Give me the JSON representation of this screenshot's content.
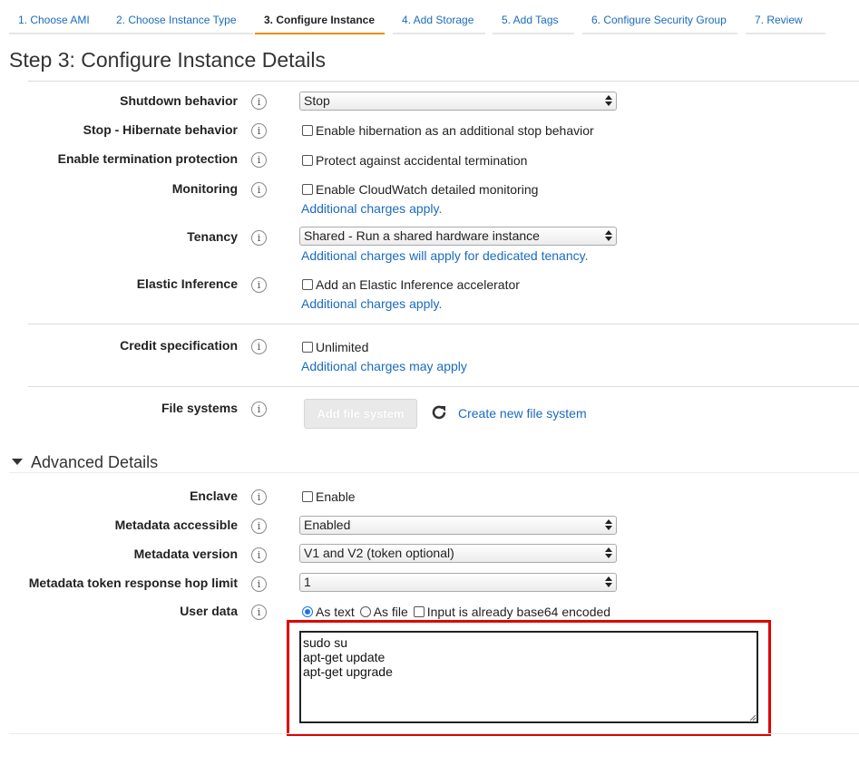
{
  "tabs": [
    {
      "label": "1. Choose AMI"
    },
    {
      "label": "2. Choose Instance Type"
    },
    {
      "label": "3. Configure Instance"
    },
    {
      "label": "4. Add Storage"
    },
    {
      "label": "5. Add Tags"
    },
    {
      "label": "6. Configure Security Group"
    },
    {
      "label": "7. Review"
    }
  ],
  "active_tab": "3. Configure Instance",
  "page_title": "Step 3: Configure Instance Details",
  "info_glyph": "i",
  "fields": {
    "shutdown": {
      "label": "Shutdown behavior",
      "value": "Stop"
    },
    "hibernate": {
      "label": "Stop - Hibernate behavior",
      "checkbox": "Enable hibernation as an additional stop behavior"
    },
    "termination": {
      "label": "Enable termination protection",
      "checkbox": "Protect against accidental termination"
    },
    "monitoring": {
      "label": "Monitoring",
      "checkbox": "Enable CloudWatch detailed monitoring",
      "link": "Additional charges apply."
    },
    "tenancy": {
      "label": "Tenancy",
      "value": "Shared - Run a shared hardware instance",
      "link": "Additional charges will apply for dedicated tenancy."
    },
    "elastic": {
      "label": "Elastic Inference",
      "checkbox": "Add an Elastic Inference accelerator",
      "link": "Additional charges apply."
    },
    "credit": {
      "label": "Credit specification",
      "checkbox": "Unlimited",
      "link": "Additional charges may apply"
    },
    "filesystems": {
      "label": "File systems",
      "button": "Add file system",
      "link": "Create new file system"
    }
  },
  "advanced": {
    "heading": "Advanced Details",
    "enclave": {
      "label": "Enclave",
      "checkbox": "Enable"
    },
    "metadata_accessible": {
      "label": "Metadata accessible",
      "value": "Enabled"
    },
    "metadata_version": {
      "label": "Metadata version",
      "value": "V1 and V2 (token optional)"
    },
    "hop_limit": {
      "label": "Metadata token response hop limit",
      "value": "1"
    },
    "user_data": {
      "label": "User data",
      "radio_text": "As text",
      "radio_file": "As file",
      "base64": "Input is already base64 encoded",
      "selected": "As text",
      "content": "sudo su\napt-get update\napt-get upgrade"
    }
  },
  "colors": {
    "accent_tab": "#e69100",
    "link": "#1a6bbf",
    "highlight": "#e00000"
  }
}
